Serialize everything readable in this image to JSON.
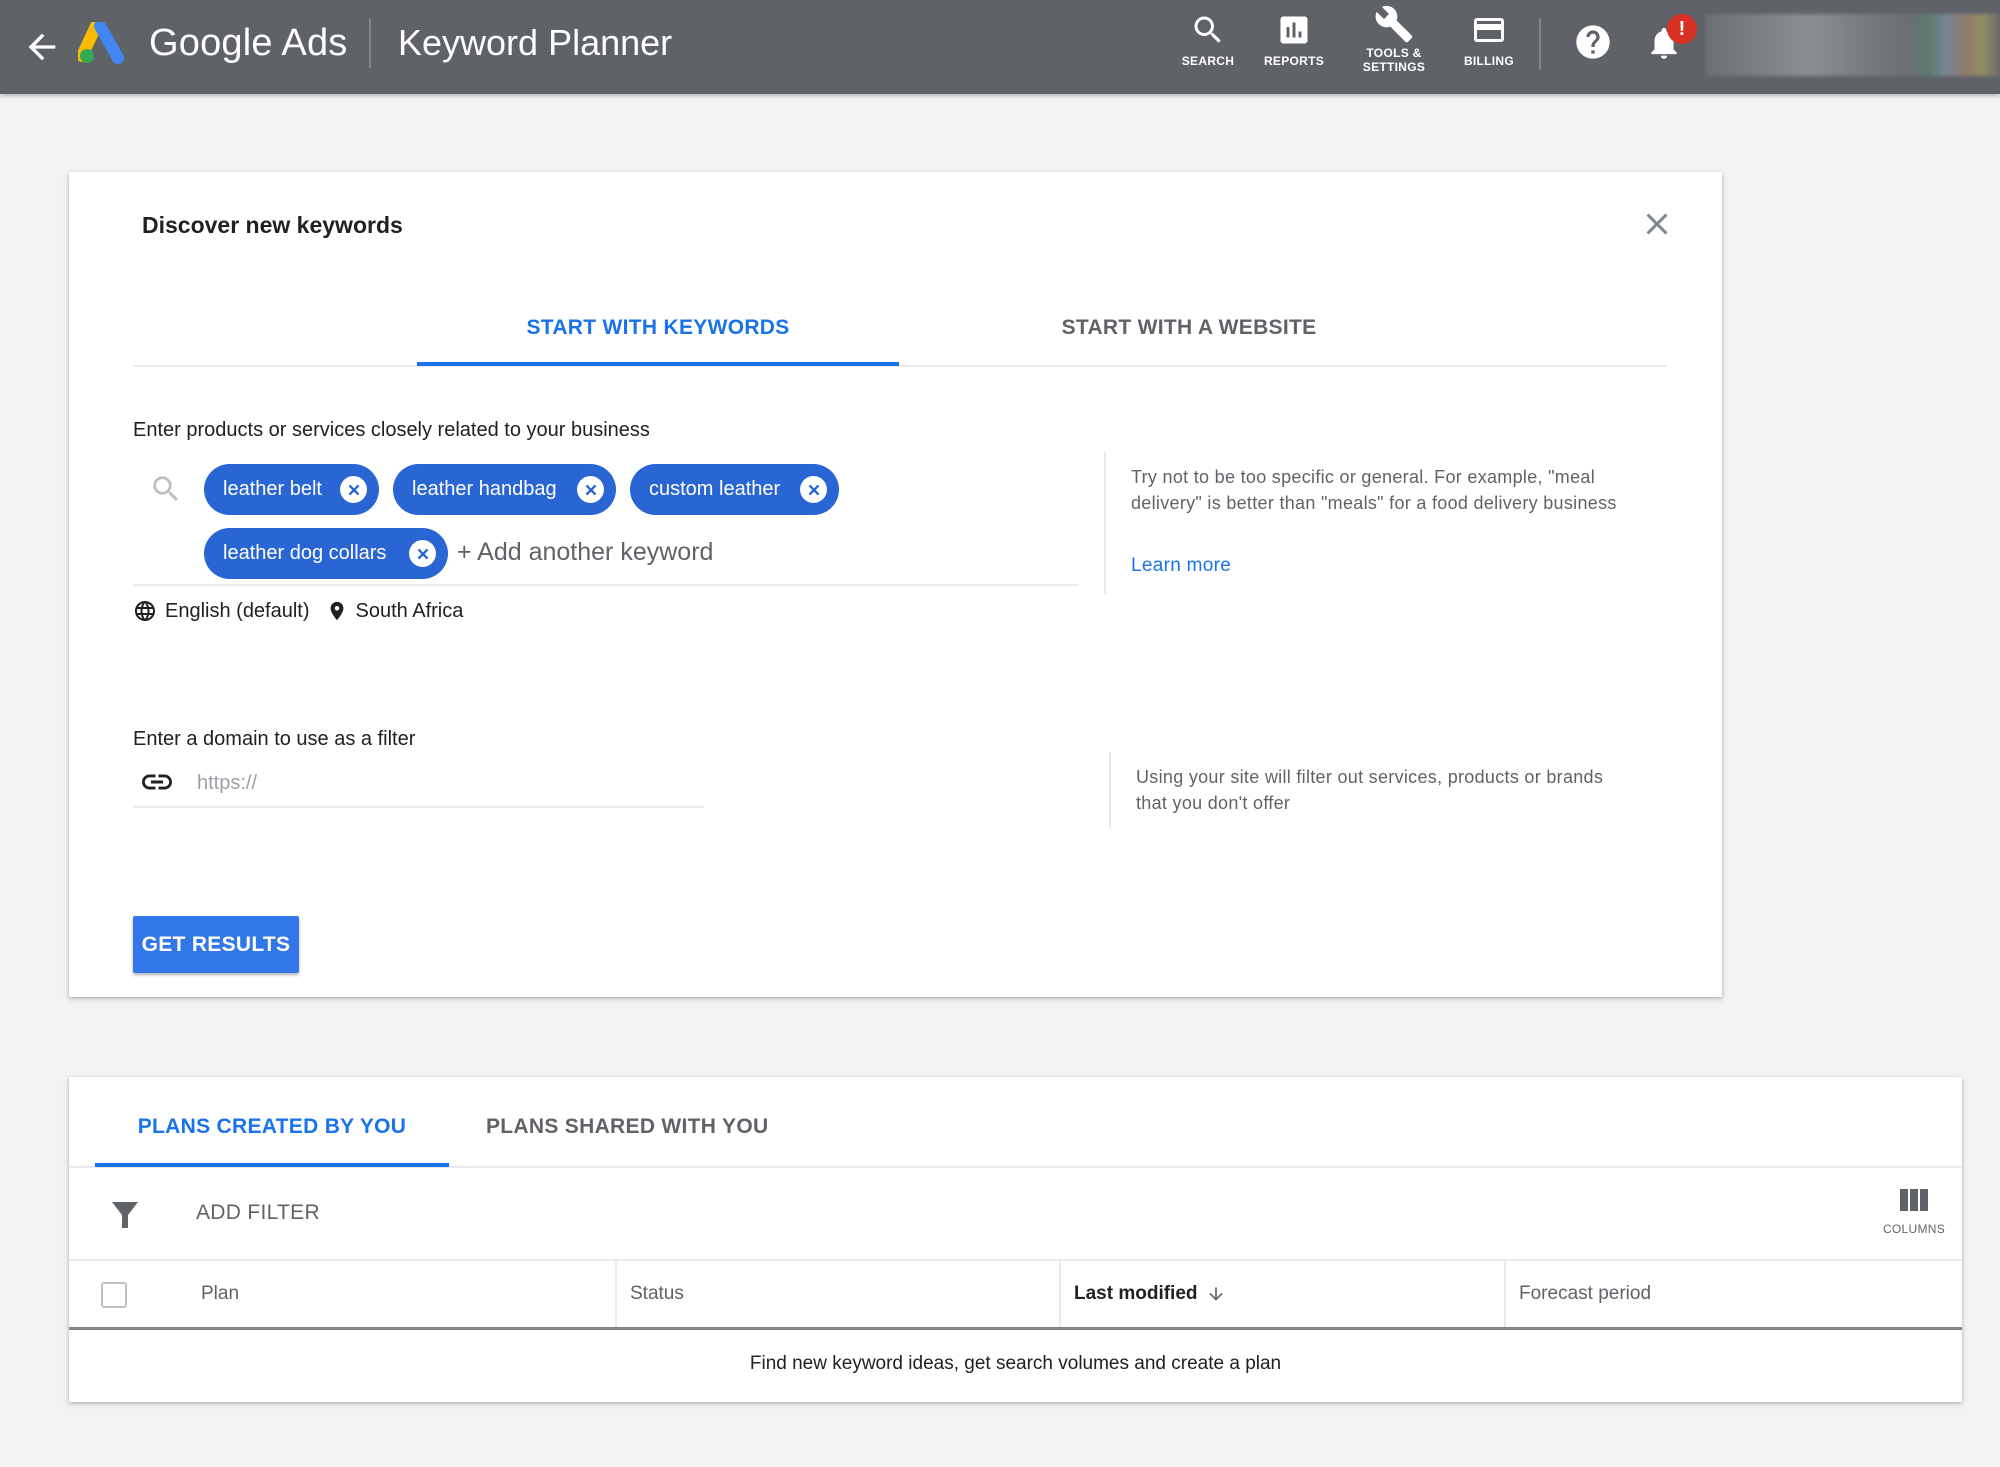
{
  "header": {
    "brand": "Google Ads",
    "product": "Keyword Planner",
    "nav": [
      {
        "label": "SEARCH",
        "icon": "search-icon"
      },
      {
        "label": "REPORTS",
        "icon": "reports-icon"
      },
      {
        "label_line1": "TOOLS &",
        "label_line2": "SETTINGS",
        "icon": "wrench-icon"
      },
      {
        "label": "BILLING",
        "icon": "credit-card-icon"
      }
    ],
    "notification_badge": "!"
  },
  "discover": {
    "title": "Discover new keywords",
    "tabs": [
      {
        "label": "START WITH KEYWORDS",
        "active": true
      },
      {
        "label": "START WITH A WEBSITE",
        "active": false
      }
    ],
    "keywords_label": "Enter products or services closely related to your business",
    "keywords": [
      "leather belt",
      "leather handbag",
      "custom leather",
      "leather dog collars"
    ],
    "add_keyword_placeholder": "+ Add another keyword",
    "language": "English (default)",
    "location": "South Africa",
    "help_text": "Try not to be too specific or general. For example, \"meal delivery\" is better than \"meals\" for a food delivery business",
    "learn_more": "Learn more",
    "domain_label": "Enter a domain to use as a filter",
    "domain_placeholder": "https://",
    "domain_value": "",
    "domain_help": "Using your site will filter out services, products or brands that you don't offer",
    "submit_label": "GET RESULTS"
  },
  "plans": {
    "tabs": [
      {
        "label": "PLANS CREATED BY YOU",
        "active": true
      },
      {
        "label": "PLANS SHARED WITH YOU",
        "active": false
      }
    ],
    "add_filter": "ADD FILTER",
    "columns_label": "COLUMNS",
    "table_headers": [
      "Plan",
      "Status",
      "Last modified",
      "Forecast period"
    ],
    "sorted_column": "Last modified",
    "empty_message": "Find new keyword ideas, get search volumes and create a plan"
  },
  "colors": {
    "header_bg": "#5f6368",
    "accent": "#1a73e8",
    "chip": "#2966d4",
    "badge": "#d93025"
  }
}
